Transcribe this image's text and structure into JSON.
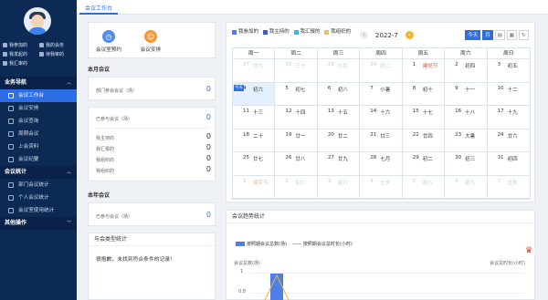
{
  "colors": {
    "accent": "#2d6ee6",
    "sidebar": "#0d2a55",
    "warn": "#f3b530",
    "legend_attended": "#4e7ee8",
    "legend_hosted": "#3c5bd1",
    "legend_reported": "#3db6e6",
    "legend_organized": "#f2c14e"
  },
  "sidebar": {
    "quick": [
      {
        "label": "我参加的",
        "icon": "doc-icon"
      },
      {
        "label": "我的会务",
        "icon": "calendar-icon"
      },
      {
        "label": "我发起的",
        "icon": "send-icon"
      },
      {
        "label": "待我审的",
        "icon": "check-icon"
      },
      {
        "label": "我汇审的",
        "icon": "list-icon"
      }
    ],
    "sections": [
      {
        "title": "业务导航",
        "chevron": "︿"
      },
      {
        "title": "会议统计",
        "chevron": "︿"
      },
      {
        "title": "其他操作",
        "chevron": "﹀"
      }
    ],
    "nav_business": [
      "会议工作台",
      "会议安排",
      "会议查询",
      "周期会议",
      "上会资料",
      "会议纪要"
    ],
    "nav_stats": [
      "部门会议统计",
      "个人会议统计",
      "会议室使用统计"
    ]
  },
  "topbar": {
    "tab": "会议工作台"
  },
  "quick_actions": [
    {
      "label": "会议室预约",
      "icon": "clock-icon",
      "glyph": "◷",
      "color": "#4e8ff0"
    },
    {
      "label": "会议安排",
      "icon": "meeting-icon",
      "glyph": "☺",
      "color": "#f29a3c"
    }
  ],
  "monthly": {
    "title": "本月会议",
    "attended_label": "部门参会会议（场）",
    "attended_value": "0",
    "rows": [
      {
        "label": "已参与会议（场）",
        "value": "0"
      },
      {
        "label": "我主持的",
        "value": "0"
      },
      {
        "label": "我汇报的",
        "value": "0"
      },
      {
        "label": "我组织的",
        "value": "0"
      },
      {
        "label": "我组织的",
        "value": "0"
      }
    ]
  },
  "yearly": {
    "title": "本年会议",
    "label": "已参与会议（场）",
    "value": "0"
  },
  "type_stats": {
    "title": "与会类型统计",
    "empty": "很抱歉，未找到符合条件的记录！"
  },
  "calendar": {
    "legend": [
      "我参加的",
      "我主持的",
      "我汇报的",
      "我组织的"
    ],
    "month": "2022-7",
    "prev": "‹",
    "next": "›",
    "tools": [
      "今天",
      "月",
      "▤",
      "▦",
      "↻"
    ],
    "weekdays": [
      "周一",
      "周二",
      "周三",
      "周四",
      "周五",
      "周六",
      "周日"
    ],
    "today_badge": "今天",
    "cells": [
      {
        "d": "27",
        "l": "廿九",
        "other": true
      },
      {
        "d": "28",
        "l": "三十",
        "other": true
      },
      {
        "d": "29",
        "l": "六月",
        "other": true
      },
      {
        "d": "30",
        "l": "初二",
        "other": true
      },
      {
        "d": "1",
        "l": "建党节"
      },
      {
        "d": "2",
        "l": "初四"
      },
      {
        "d": "3",
        "l": "初五"
      },
      {
        "d": "4",
        "l": "初六",
        "today": true
      },
      {
        "d": "5",
        "l": "初七"
      },
      {
        "d": "6",
        "l": "初八"
      },
      {
        "d": "7",
        "l": "小暑"
      },
      {
        "d": "8",
        "l": "初十"
      },
      {
        "d": "9",
        "l": "十一"
      },
      {
        "d": "10",
        "l": "十二"
      },
      {
        "d": "11",
        "l": "十三"
      },
      {
        "d": "12",
        "l": "十四"
      },
      {
        "d": "13",
        "l": "十五"
      },
      {
        "d": "14",
        "l": "十六"
      },
      {
        "d": "15",
        "l": "十七"
      },
      {
        "d": "16",
        "l": "十八"
      },
      {
        "d": "17",
        "l": "十九"
      },
      {
        "d": "18",
        "l": "二十"
      },
      {
        "d": "19",
        "l": "廿一"
      },
      {
        "d": "20",
        "l": "廿二"
      },
      {
        "d": "21",
        "l": "廿三"
      },
      {
        "d": "22",
        "l": "廿四"
      },
      {
        "d": "23",
        "l": "大暑"
      },
      {
        "d": "24",
        "l": "廿六"
      },
      {
        "d": "25",
        "l": "廿七"
      },
      {
        "d": "26",
        "l": "廿八"
      },
      {
        "d": "27",
        "l": "廿九"
      },
      {
        "d": "28",
        "l": "七月"
      },
      {
        "d": "29",
        "l": "初二"
      },
      {
        "d": "30",
        "l": "初三"
      },
      {
        "d": "31",
        "l": "初四"
      },
      {
        "d": "1",
        "l": "建军节",
        "other": true
      },
      {
        "d": "2",
        "l": "初六",
        "other": true
      },
      {
        "d": "3",
        "l": "初六",
        "other": true
      },
      {
        "d": "4",
        "l": "七夕",
        "other": true
      },
      {
        "d": "5",
        "l": "初八",
        "other": true
      },
      {
        "d": "6",
        "l": "初九",
        "other": true
      },
      {
        "d": "7",
        "l": "立秋",
        "other": true
      }
    ]
  },
  "trend": {
    "title": "会议趋势统计",
    "legend_a": "按照期会议总数(场)",
    "legend_b": "按照期会议总时长(小时)",
    "yleft": "会议总数(场)",
    "yright": "会议总时长(小时)",
    "ticks": [
      "1",
      "0.8"
    ]
  },
  "fab": {
    "icon": "logo-icon",
    "glyph": "♛"
  }
}
